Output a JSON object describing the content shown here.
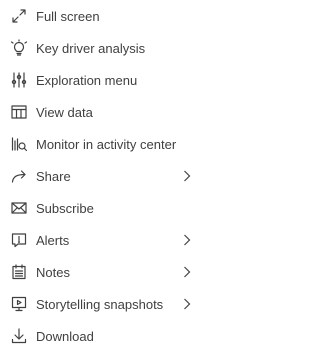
{
  "menu": {
    "items": [
      {
        "label": "Full screen",
        "icon": "expand-icon",
        "submenu": false
      },
      {
        "label": "Key driver analysis",
        "icon": "lightbulb-icon",
        "submenu": false
      },
      {
        "label": "Exploration menu",
        "icon": "sliders-icon",
        "submenu": false
      },
      {
        "label": "View data",
        "icon": "table-icon",
        "submenu": false
      },
      {
        "label": "Monitor in activity center",
        "icon": "monitor-chart-icon",
        "submenu": false
      },
      {
        "label": "Share",
        "icon": "share-arrow-icon",
        "submenu": true
      },
      {
        "label": "Subscribe",
        "icon": "envelope-icon",
        "submenu": false
      },
      {
        "label": "Alerts",
        "icon": "alert-icon",
        "submenu": true
      },
      {
        "label": "Notes",
        "icon": "notes-icon",
        "submenu": true
      },
      {
        "label": "Storytelling snapshots",
        "icon": "presentation-icon",
        "submenu": true
      },
      {
        "label": "Download",
        "icon": "download-icon",
        "submenu": false
      }
    ]
  },
  "colors": {
    "text": "#404040",
    "background": "#ffffff"
  }
}
